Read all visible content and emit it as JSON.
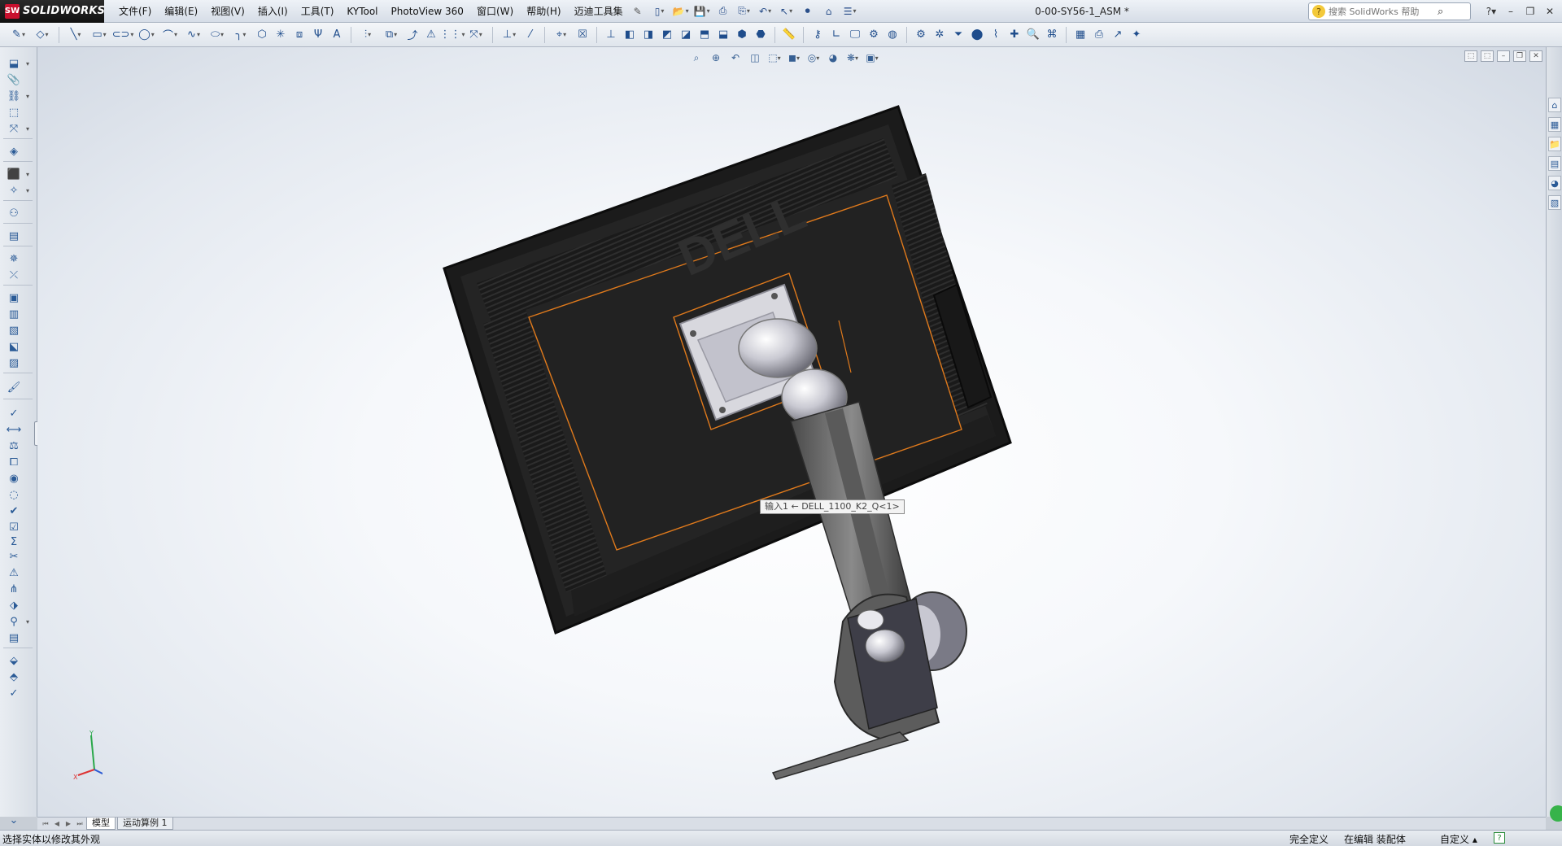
{
  "app": {
    "name": "SOLIDWORKS",
    "badge": "SW",
    "doc_title": "0-00-SY56-1_ASM *"
  },
  "menu": {
    "items": [
      "文件(F)",
      "编辑(E)",
      "视图(V)",
      "插入(I)",
      "工具(T)",
      "KYTool",
      "PhotoView 360",
      "窗口(W)",
      "帮助(H)",
      "迈迪工具集"
    ]
  },
  "help_search": {
    "placeholder": "搜索 SolidWorks 帮助"
  },
  "viewport": {
    "tooltip": "输入1 ← DELL_1100_K2_Q<1>",
    "brand_logo": "DELL",
    "triad_axes": {
      "x": "X",
      "y": "Y"
    }
  },
  "tabs": {
    "model": "模型",
    "motion": "运动算例 1"
  },
  "status": {
    "message": "选择实体以修改其外观",
    "fully_defined": "完全定义",
    "editing": "在编辑 装配体",
    "custom": "自定义 ▴",
    "help": "?"
  },
  "icons": {
    "accent": "#1f4d8c",
    "brand_red": "#c8102e",
    "monitor_body": "#1e1e1e",
    "highlight_orange": "#e07a1c"
  }
}
